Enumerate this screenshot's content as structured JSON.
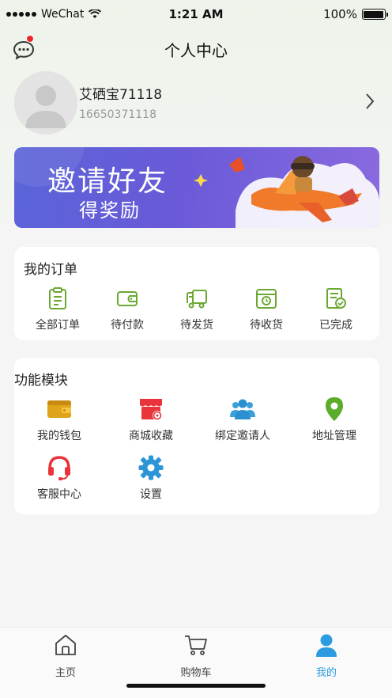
{
  "status_bar": {
    "carrier": "WeChat",
    "time": "1:21 AM",
    "battery": "100%"
  },
  "header": {
    "title": "个人中心"
  },
  "profile": {
    "name": "艾硒宝71118",
    "phone": "16650371118"
  },
  "banner": {
    "title": "邀请好友",
    "subtitle": "得奖励"
  },
  "orders": {
    "title": "我的订单",
    "items": [
      {
        "label": "全部订单",
        "icon": "clipboard-icon"
      },
      {
        "label": "待付款",
        "icon": "wallet-icon"
      },
      {
        "label": "待发货",
        "icon": "truck-icon"
      },
      {
        "label": "待收货",
        "icon": "box-clock-icon"
      },
      {
        "label": "已完成",
        "icon": "doc-check-icon"
      }
    ]
  },
  "functions": {
    "title": "功能模块",
    "items": [
      {
        "label": "我的钱包",
        "icon": "wallet-icon"
      },
      {
        "label": "商城收藏",
        "icon": "shop-heart-icon"
      },
      {
        "label": "绑定邀请人",
        "icon": "people-icon"
      },
      {
        "label": "地址管理",
        "icon": "location-pin-icon"
      },
      {
        "label": "客服中心",
        "icon": "headset-icon"
      },
      {
        "label": "设置",
        "icon": "gear-icon"
      }
    ]
  },
  "tabbar": {
    "items": [
      {
        "label": "主页",
        "icon": "home-icon"
      },
      {
        "label": "购物车",
        "icon": "cart-icon"
      },
      {
        "label": "我的",
        "icon": "user-icon"
      }
    ]
  },
  "colors": {
    "accent_green": "#6aa832",
    "tab_active_blue": "#2c9be0",
    "badge_red": "#e62828",
    "banner_purple": "#6a5ad8"
  }
}
